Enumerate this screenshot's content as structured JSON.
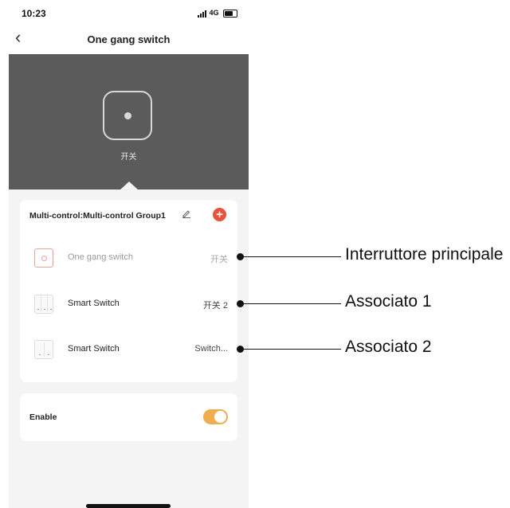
{
  "status_bar": {
    "time": "10:23",
    "network": "4G"
  },
  "nav": {
    "back_icon": "chevron-left-icon",
    "title": "One gang switch"
  },
  "hero": {
    "switch_label": "开关"
  },
  "group": {
    "title": "Multi-control:Multi-control Group1",
    "add_label": "+",
    "accent_color": "#e8533b",
    "rows": [
      {
        "name": "One gang switch",
        "value": "开关"
      },
      {
        "name": "Smart Switch",
        "value": "开关 2"
      },
      {
        "name": "Smart Switch",
        "value": "Switch..."
      }
    ]
  },
  "enable": {
    "label": "Enable",
    "toggle_on": true,
    "toggle_color": "#f0ad4e"
  },
  "annotations": [
    {
      "text": "Interruttore principale"
    },
    {
      "text": "Associato 1"
    },
    {
      "text": "Associato 2"
    }
  ]
}
